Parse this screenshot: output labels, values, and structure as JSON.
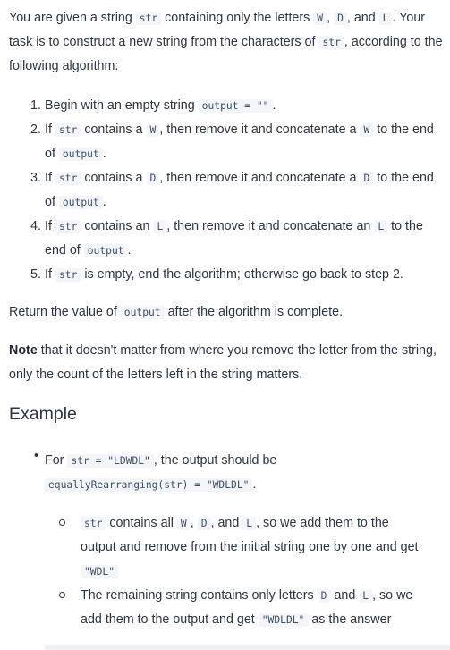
{
  "intro": {
    "t1": "You are given a string",
    "c1": "str",
    "t2": "containing only the letters",
    "c2": "W",
    "t3": ",",
    "c3": "D",
    "t4": ", and",
    "c4": "L",
    "t5": ". Your task is to construct a new string from the characters of",
    "c5": "str",
    "t6": ", according to the following algorithm:"
  },
  "steps": [
    {
      "num": "1.",
      "a": "Begin with an empty string",
      "c1": "output = \"\"",
      "b": "."
    },
    {
      "num": "2.",
      "a": "If",
      "c1": "str",
      "b": "contains a",
      "c2": "W",
      "c": ", then remove it and concatenate a",
      "c3": "W",
      "d": "to the end of",
      "c4": "output",
      "e": "."
    },
    {
      "num": "3.",
      "a": "If",
      "c1": "str",
      "b": "contains a",
      "c2": "D",
      "c": ", then remove it and concatenate a",
      "c3": "D",
      "d": "to the end of",
      "c4": "output",
      "e": "."
    },
    {
      "num": "4.",
      "a": "If",
      "c1": "str",
      "b": "contains an",
      "c2": "L",
      "c": ", then remove it and concatenate an",
      "c3": "L",
      "d": "to the end of",
      "c4": "output",
      "e": "."
    },
    {
      "num": "5.",
      "a": "If",
      "c1": "str",
      "b": "is empty, end the algorithm; otherwise go back to step 2."
    }
  ],
  "return_text": {
    "a": "Return the value of",
    "c": "output",
    "b": "after the algorithm is complete."
  },
  "note": {
    "bold": "Note",
    "rest": "that it doesn't matter from where you remove the letter from the string, only the count of the letters left in the string matters."
  },
  "example": {
    "heading": "Example",
    "bullet": "•",
    "e1": "For",
    "c1": "str = \"LDWDL\"",
    "e2": ", the output should be",
    "c2": "equallyRearranging(str) = \"WDLDL\"",
    "e3": ".",
    "sub1": {
      "c1": "str",
      "a": "contains all",
      "c2": "W",
      "b": ",",
      "c3": "D",
      "c": ", and",
      "c4": "L",
      "d": ", so we add them to the output and remove from the initial string one by one and get",
      "c5": "\"WDL\""
    },
    "sub2": {
      "a": "The remaining string contains only letters",
      "c1": "D",
      "b": "and",
      "c2": "L",
      "c": ", so we add them to the output and get",
      "c3": "\"WDLDL\"",
      "d": "as the answer"
    }
  }
}
